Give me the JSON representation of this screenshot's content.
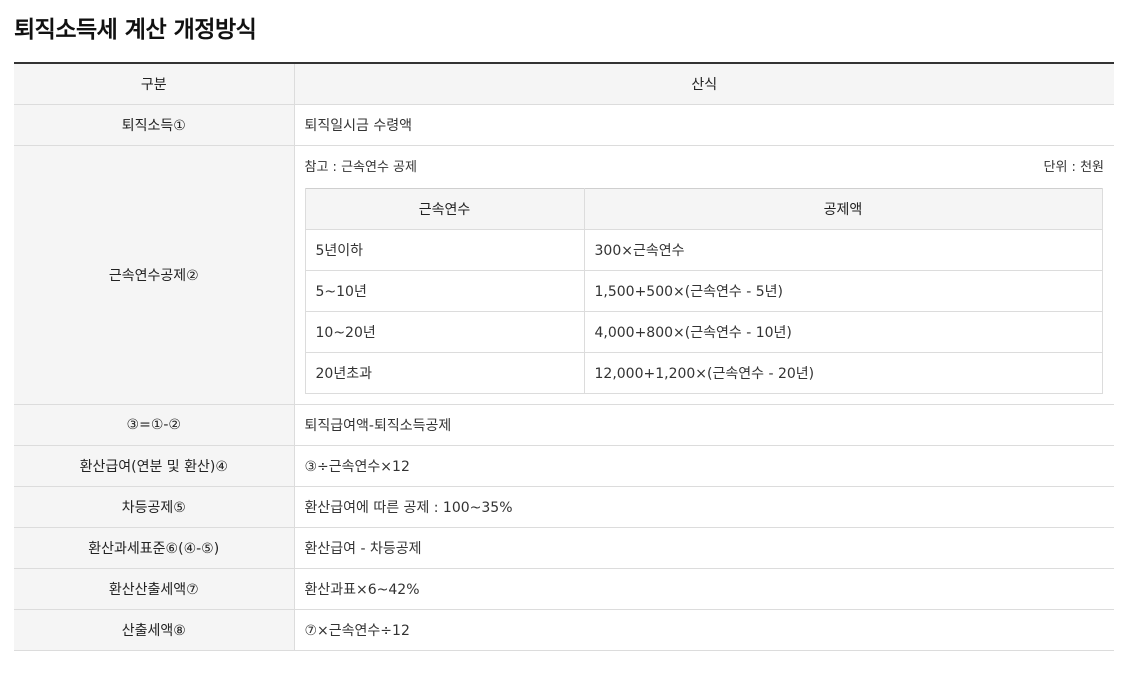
{
  "title": "퇴직소득세 계산 개정방식",
  "header": {
    "col1": "구분",
    "col2": "산식"
  },
  "rows": {
    "r1": {
      "label": "퇴직소득①",
      "value": "퇴직일시금 수령액"
    },
    "r2": {
      "label": "근속연수공제②",
      "note_left": "참고 : 근속연수 공제",
      "note_right": "단위 : 천원",
      "sub_header": {
        "col1": "근속연수",
        "col2": "공제액"
      },
      "sub_rows": [
        {
          "years": "5년이하",
          "amount": "300×근속연수"
        },
        {
          "years": "5~10년",
          "amount": "1,500+500×(근속연수 - 5년)"
        },
        {
          "years": "10~20년",
          "amount": "4,000+800×(근속연수 - 10년)"
        },
        {
          "years": "20년초과",
          "amount": "12,000+1,200×(근속연수 - 20년)"
        }
      ]
    },
    "r3": {
      "label": "③=①-②",
      "value": "퇴직급여액-퇴직소득공제"
    },
    "r4": {
      "label": "환산급여(연분 및 환산)④",
      "value": "③÷근속연수×12"
    },
    "r5": {
      "label": "차등공제⑤",
      "value": "환산급여에 따른 공제 : 100~35%"
    },
    "r6": {
      "label": "환산과세표준⑥(④-⑤)",
      "value": "환산급여 - 차등공제"
    },
    "r7": {
      "label": "환산산출세액⑦",
      "value": "환산과표×6~42%"
    },
    "r8": {
      "label": "산출세액⑧",
      "value": "⑦×근속연수÷12"
    }
  }
}
